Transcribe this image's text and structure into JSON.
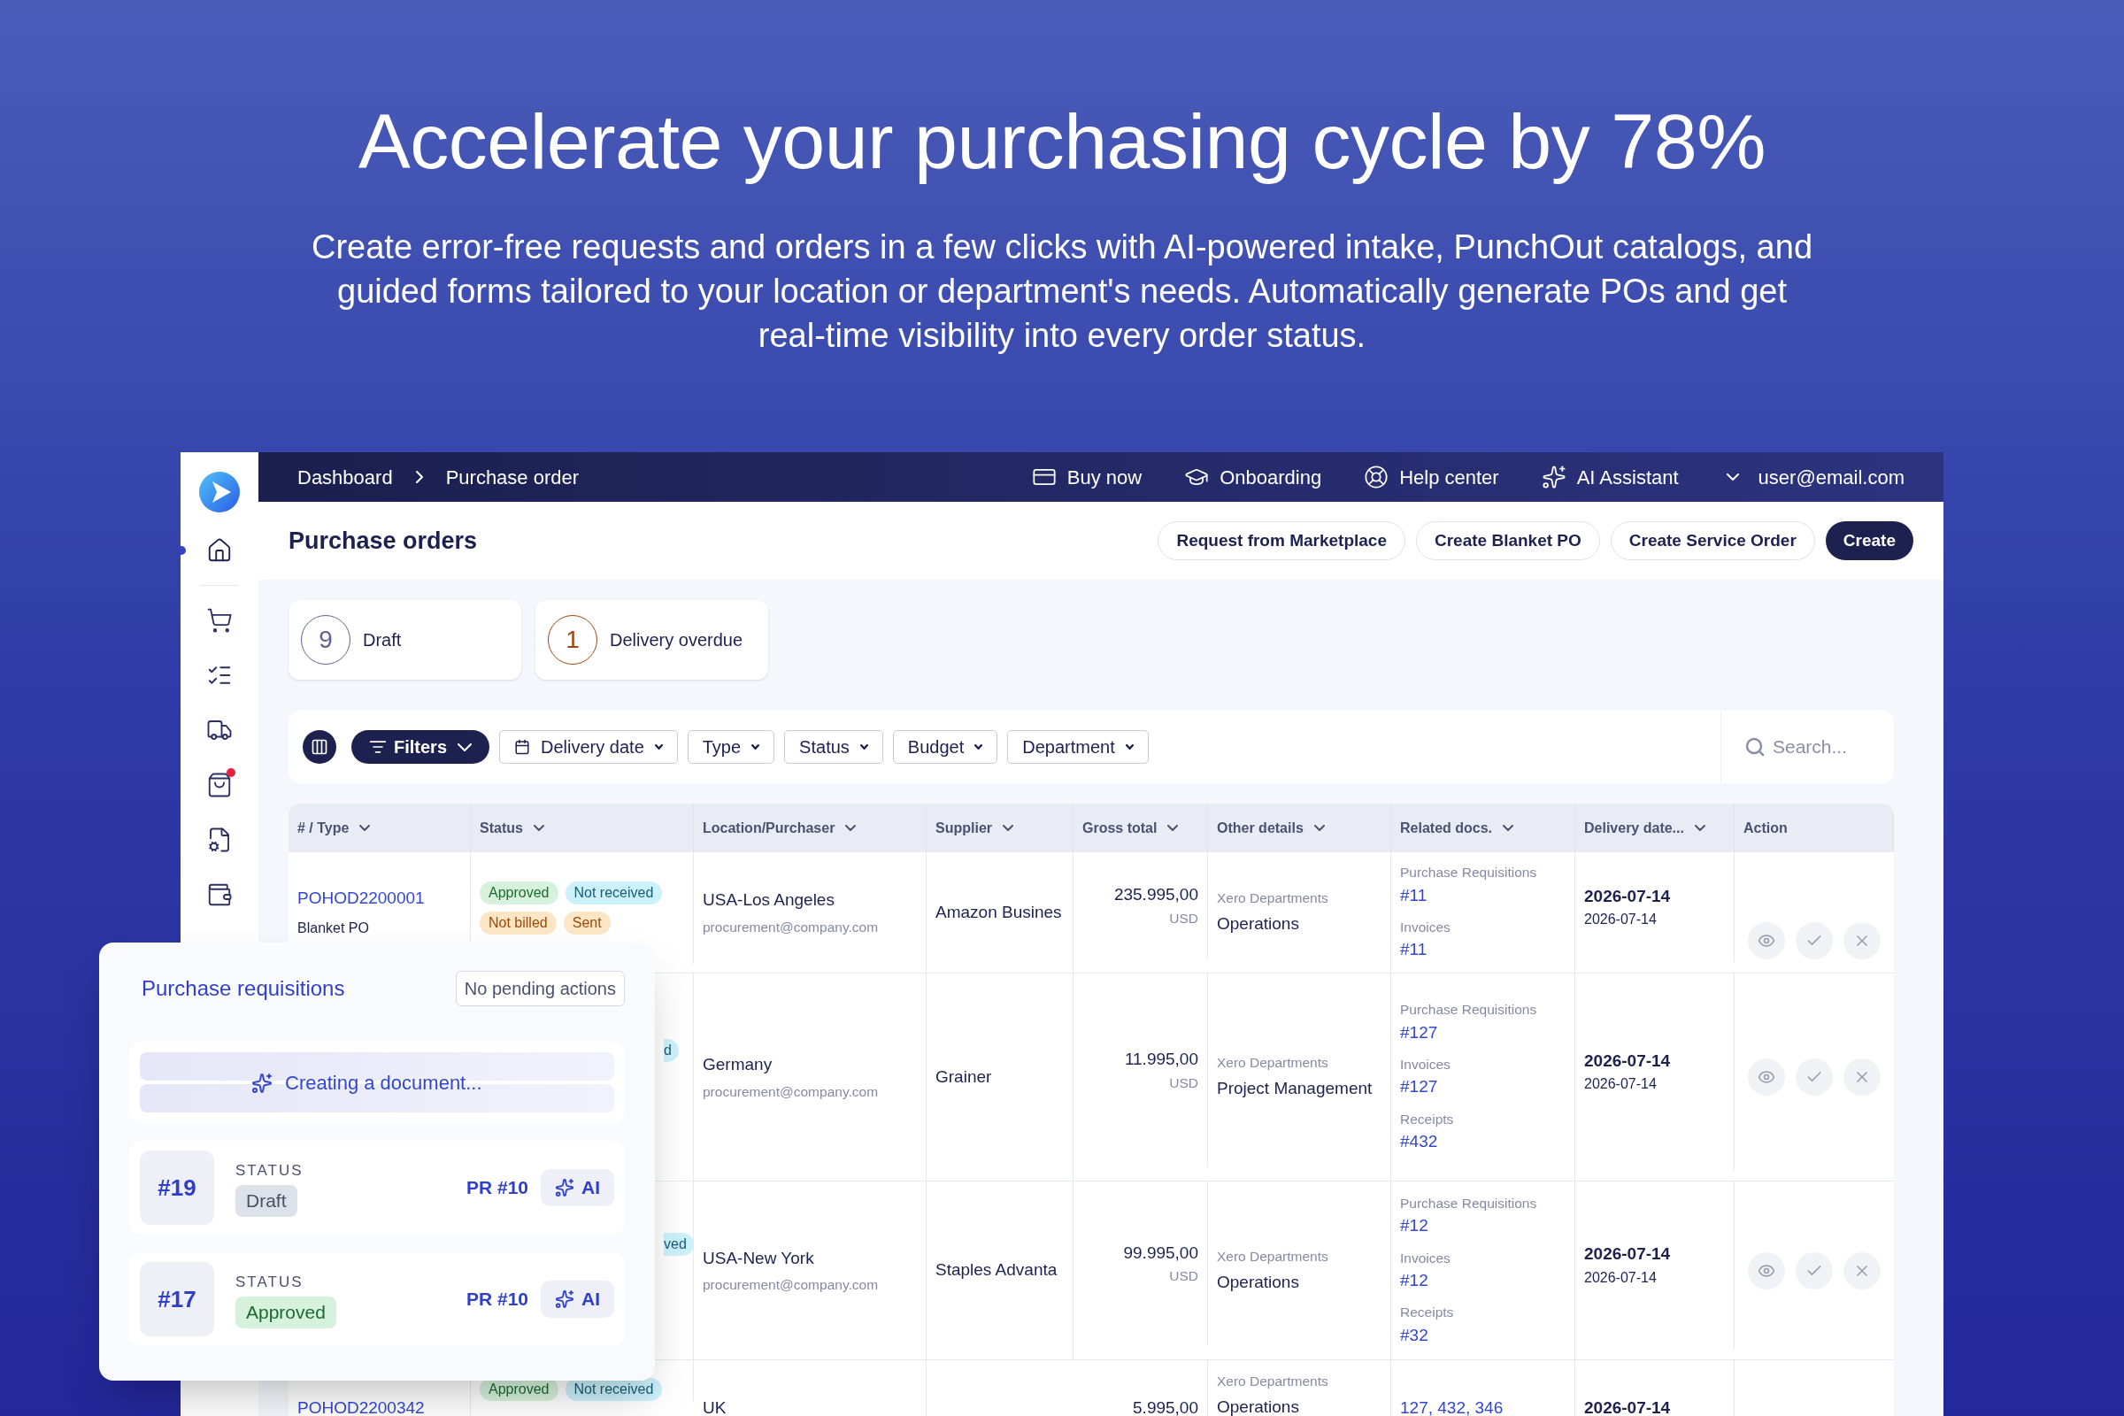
{
  "hero": {
    "title": "Accelerate your purchasing cycle by 78%",
    "subtitle": "Create error-free requests and orders in a few clicks with AI-powered intake, PunchOut catalogs, and guided forms tailored to your location or department's needs. Automatically generate POs and get real-time visibility into every order status."
  },
  "sidebar": {
    "items": [
      {
        "selected": true,
        "alert": false
      },
      {
        "selected": false,
        "alert": false
      },
      {
        "selected": false,
        "alert": false
      },
      {
        "selected": false,
        "alert": false
      },
      {
        "selected": false,
        "alert": true
      },
      {
        "selected": false,
        "alert": false
      },
      {
        "selected": false,
        "alert": false
      }
    ]
  },
  "topbar": {
    "breadcrumbs": [
      "Dashboard",
      "Purchase order"
    ],
    "links": [
      "Buy now",
      "Onboarding",
      "Help center",
      "AI Assistant"
    ],
    "user": "user@email.com"
  },
  "page": {
    "title": "Purchase orders",
    "buttons": [
      {
        "label": "Request from Marketplace",
        "primary": false
      },
      {
        "label": "Create Blanket PO",
        "primary": false
      },
      {
        "label": "Create Service Order",
        "primary": false
      },
      {
        "label": "Create",
        "primary": true
      }
    ]
  },
  "stats": [
    {
      "count": "9",
      "label": "Draft",
      "color": "#5b6290"
    },
    {
      "count": "1",
      "label": "Delivery overdue",
      "color": "#a0440f"
    }
  ],
  "filters": {
    "filters_button": "Filters",
    "dropdowns": [
      "Delivery date",
      "Type",
      "Status",
      "Budget",
      "Department"
    ],
    "search": {
      "placeholder": "Search..."
    }
  },
  "table": {
    "columns": [
      {
        "label": "# / Type",
        "sortable": true
      },
      {
        "label": "Status",
        "sortable": true
      },
      {
        "label": "Location/Purchaser",
        "sortable": true
      },
      {
        "label": "Supplier",
        "sortable": true
      },
      {
        "label": "Gross total",
        "sortable": true
      },
      {
        "label": "Other details",
        "sortable": true
      },
      {
        "label": "Related docs.",
        "sortable": true
      },
      {
        "label": "Delivery date...",
        "sortable": true
      },
      {
        "label": "Action",
        "sortable": false
      }
    ],
    "rows": [
      {
        "id": "POHOD2200001",
        "type": "Blanket PO",
        "tags": [
          {
            "text": "Approved",
            "color": "#d6f2dc",
            "kind": "full"
          },
          {
            "text": "Not received",
            "color": "#cdf1fb",
            "kind": "full"
          },
          {
            "text": "Not billed",
            "color": "#fde6c6",
            "kind": "full"
          },
          {
            "text": "Sent",
            "color": "#fde6c6",
            "kind": "full"
          }
        ],
        "location": "USA-Los Angeles",
        "email": "procurement@company.com",
        "supplier": "Amazon Busines",
        "total": "235.995,00",
        "currency": "USD",
        "dept_label": "Xero Departments",
        "dept": "Operations",
        "docs": [
          {
            "label": "Purchase Requisitions",
            "link": "#11"
          },
          {
            "label": "Invoices",
            "link": "#11"
          }
        ],
        "date_main": "2026-07-14",
        "date_sub": "2026-07-14"
      },
      {
        "tags": [
          {
            "text": "d",
            "color": "#cdf1fb",
            "kind": "fragment"
          }
        ],
        "location": "Germany",
        "email": "procurement@company.com",
        "supplier": "Grainer",
        "total": "11.995,00",
        "currency": "USD",
        "dept_label": "Xero Departments",
        "dept": "Project Management",
        "docs": [
          {
            "label": "Purchase Requisitions",
            "link": "#127"
          },
          {
            "label": "Invoices",
            "link": "#127"
          },
          {
            "label": "Receipts",
            "link": "#432"
          }
        ],
        "date_main": "2026-07-14",
        "date_sub": "2026-07-14"
      },
      {
        "tags": [
          {
            "text": "ved",
            "color": "#cdf1fb",
            "kind": "fragment"
          }
        ],
        "location": "USA-New York",
        "email": "procurement@company.com",
        "supplier": "Staples Advanta",
        "total": "99.995,00",
        "currency": "USD",
        "dept_label": "Xero Departments",
        "dept": "Operations",
        "docs": [
          {
            "label": "Purchase Requisitions",
            "link": "#12"
          },
          {
            "label": "Invoices",
            "link": "#12"
          },
          {
            "label": "Receipts",
            "link": "#32"
          }
        ],
        "date_main": "2026-07-14",
        "date_sub": "2026-07-14"
      },
      {
        "id": "POHOD2200342",
        "tags": [
          {
            "text": "Approved",
            "color": "#d6f2dc",
            "kind": "full"
          },
          {
            "text": "Not received",
            "color": "#cdf1fb",
            "kind": "full"
          }
        ],
        "location": "UK",
        "total": "5.995,00",
        "dept_label": "Xero Departments",
        "dept": "Operations",
        "docs": [
          {
            "link": "127, 432, 346"
          }
        ],
        "date_main": "2026-07-14"
      }
    ]
  },
  "requisitions": {
    "title": "Purchase requisitions",
    "badge": "No pending actions",
    "loading": "Creating a document...",
    "items": [
      {
        "number": "#19",
        "status_label": "STATUS",
        "status": "Draft",
        "color": "#dde1ea",
        "pr": "PR #10",
        "ai": "AI"
      },
      {
        "number": "#17",
        "status_label": "STATUS",
        "status": "Approved",
        "color": "#d6f2dc",
        "pr": "PR #10",
        "ai": "AI"
      }
    ]
  }
}
